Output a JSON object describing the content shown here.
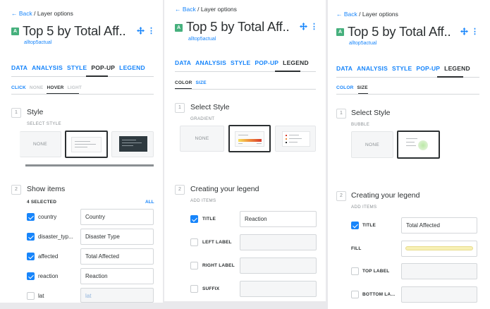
{
  "panels": [
    {
      "back_label": "Back",
      "crumb": "/ Layer options",
      "layer_letter": "A",
      "layer_title": "Top 5 by Total Aff..",
      "layer_source": "alltop5actual",
      "tabs": [
        "DATA",
        "ANALYSIS",
        "STYLE",
        "POP-UP",
        "LEGEND"
      ],
      "active_tab": "POP-UP",
      "subtabs": [
        "CLICK",
        "NONE",
        "HOVER",
        "LIGHT"
      ],
      "step1": {
        "number": "1",
        "title": "Style",
        "caption": "SELECT STYLE",
        "cards": [
          "NONE",
          "",
          ""
        ]
      },
      "step2": {
        "number": "2",
        "title": "Show items",
        "count": "4 SELECTED",
        "all_label": "ALL",
        "rows": [
          {
            "field": "country",
            "value": "Country",
            "checked": true
          },
          {
            "field": "disaster_typ...",
            "value": "Disaster Type",
            "checked": true
          },
          {
            "field": "affected",
            "value": "Total Affected",
            "checked": true
          },
          {
            "field": "reaction",
            "value": "Reaction",
            "checked": true
          },
          {
            "field": "lat",
            "value": "lat",
            "checked": false
          }
        ]
      }
    },
    {
      "back_label": "Back",
      "crumb": "/ Layer options",
      "layer_letter": "A",
      "layer_title": "Top 5 by Total Aff..",
      "layer_source": "alltop5actual",
      "tabs": [
        "DATA",
        "ANALYSIS",
        "STYLE",
        "POP-UP",
        "LEGEND"
      ],
      "active_tab": "LEGEND",
      "subtabs": [
        "COLOR",
        "SIZE"
      ],
      "step1": {
        "number": "1",
        "title": "Select Style",
        "caption": "GRADIENT",
        "cards": [
          "NONE",
          "",
          ""
        ]
      },
      "step2": {
        "number": "2",
        "title": "Creating your legend",
        "caption": "ADD ITEMS",
        "rows": [
          {
            "label": "TITLE",
            "value": "Reaction",
            "checked": true
          },
          {
            "label": "LEFT LABEL",
            "value": "",
            "checked": false
          },
          {
            "label": "RIGHT LABEL",
            "value": "",
            "checked": false
          },
          {
            "label": "SUFFIX",
            "value": "",
            "checked": false
          }
        ]
      }
    },
    {
      "back_label": "Back",
      "crumb": "/ Layer options",
      "layer_letter": "A",
      "layer_title": "Top 5 by Total Aff..",
      "layer_source": "alltop5actual",
      "tabs": [
        "DATA",
        "ANALYSIS",
        "STYLE",
        "POP-UP",
        "LEGEND"
      ],
      "active_tab": "LEGEND",
      "subtabs": [
        "COLOR",
        "SIZE"
      ],
      "step1": {
        "number": "1",
        "title": "Select Style",
        "caption": "BUBBLE",
        "cards": [
          "NONE",
          ""
        ]
      },
      "step2": {
        "number": "2",
        "title": "Creating your legend",
        "caption": "ADD ITEMS",
        "rows": [
          {
            "label": "TITLE",
            "value": "Total Affected",
            "checked": true
          },
          {
            "label": "FILL",
            "value": "",
            "checked": null
          },
          {
            "label": "TOP LABEL",
            "value": "",
            "checked": false
          },
          {
            "label": "BOTTOM LA...",
            "value": "",
            "checked": false
          }
        ]
      }
    }
  ],
  "colors": {
    "accent": "#1785fb",
    "badge": "#46b07d",
    "text": "#2c3032",
    "fill_swatch": "#f7f0b5"
  },
  "icons": {
    "back": "arrow-left-icon",
    "move": "move-icon",
    "menu": "more-vertical-icon"
  }
}
